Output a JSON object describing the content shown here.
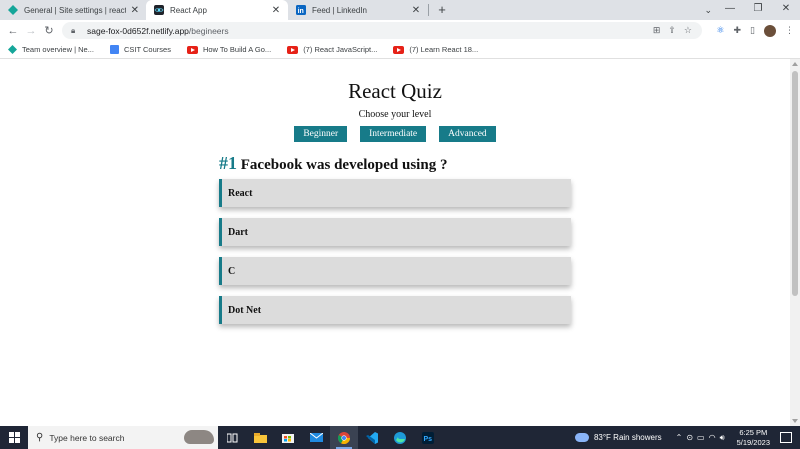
{
  "browser": {
    "tabs": [
      {
        "title": "General | Site settings | reactquiz",
        "active": false
      },
      {
        "title": "React App",
        "active": true
      },
      {
        "title": "Feed | LinkedIn",
        "active": false
      }
    ],
    "new_tab_label": "+",
    "url_host": "sage-fox-0d652f.netlify.app",
    "url_path": "/begineers",
    "bookmarks": [
      {
        "label": "Team overview | Ne...",
        "icon": "diamond-icon"
      },
      {
        "label": "CSIT Courses",
        "icon": "csit-icon"
      },
      {
        "label": "How To Build A Go...",
        "icon": "youtube-icon"
      },
      {
        "label": "(7) React JavaScript...",
        "icon": "youtube-icon"
      },
      {
        "label": "(7) Learn React 18...",
        "icon": "youtube-icon"
      }
    ]
  },
  "quiz": {
    "title": "React Quiz",
    "level_prompt": "Choose your level",
    "levels": [
      "Beginner",
      "Intermediate",
      "Advanced"
    ],
    "question_number": "#1",
    "question_text": "Facebook was developed using ?",
    "options": [
      "React",
      "Dart",
      "C",
      "Dot Net"
    ],
    "accent_color": "#177b89"
  },
  "taskbar": {
    "search_placeholder": "Type here to search",
    "weather": "83°F  Rain showers",
    "time": "6:25 PM",
    "date": "5/19/2023"
  }
}
